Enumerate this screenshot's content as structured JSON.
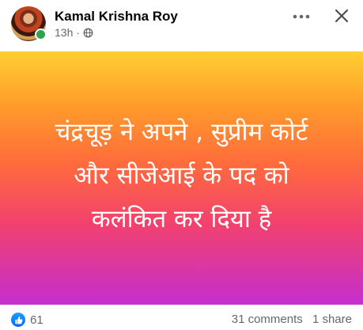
{
  "post": {
    "author": "Kamal Krishna Roy",
    "time": "13h",
    "separator": "·",
    "privacy_icon": "globe-icon",
    "banner_lines": [
      "चंद्रचूड़ ने अपने , सुप्रीम कोर्ट",
      "और सीजेआई के पद को",
      "कलंकित कर दिया है"
    ],
    "reaction_count": "61",
    "comments": "31 comments",
    "shares": "1 share"
  },
  "colors": {
    "online": "#31a24c",
    "like": "#0866ff",
    "banner_top": "#ffcf33",
    "banner_bottom": "#c52ed0"
  }
}
